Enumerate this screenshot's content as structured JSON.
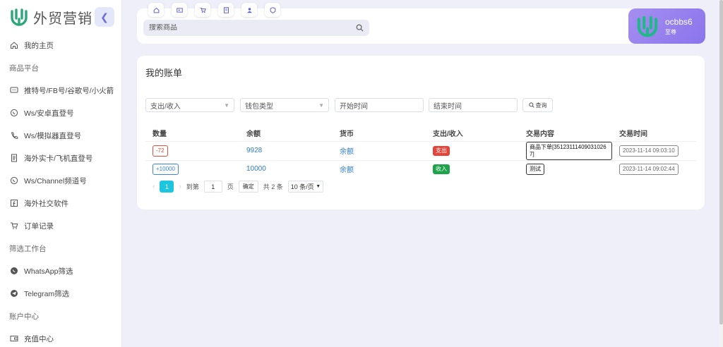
{
  "brand": {
    "name": "外贸营销",
    "color": "#2aa77b"
  },
  "sidebar": {
    "collapse_icon": "chevron-left-icon",
    "items": [
      {
        "type": "item",
        "label": "我的主页",
        "icon": "home-icon"
      },
      {
        "type": "group",
        "label": "商品平台"
      },
      {
        "type": "item",
        "label": "推特号/FB号/谷歌号/小火箭",
        "icon": "chat-icon"
      },
      {
        "type": "item",
        "label": "Ws/安卓直登号",
        "icon": "whatsapp-icon"
      },
      {
        "type": "item",
        "label": "Ws/模拟器直登号",
        "icon": "phone-icon"
      },
      {
        "type": "item",
        "label": "海外实卡/飞机直登号",
        "icon": "document-icon"
      },
      {
        "type": "item",
        "label": "Ws/Channel频道号",
        "icon": "whatsapp-icon"
      },
      {
        "type": "item",
        "label": "海外社交软件",
        "icon": "facebook-icon"
      },
      {
        "type": "item",
        "label": "订单记录",
        "icon": "cart-icon"
      },
      {
        "type": "group",
        "label": "筛选工作台"
      },
      {
        "type": "item",
        "label": "WhatsApp筛选",
        "icon": "whatsapp-fill-icon"
      },
      {
        "type": "item",
        "label": "Telegram筛选",
        "icon": "telegram-icon"
      },
      {
        "type": "group",
        "label": "账户中心"
      },
      {
        "type": "item",
        "label": "充值中心",
        "icon": "wallet-icon"
      }
    ]
  },
  "header": {
    "tabs": [
      "home-icon",
      "card-icon",
      "cart-icon",
      "list-icon",
      "user-icon",
      "shield-icon"
    ],
    "search": {
      "placeholder": "搜索商品",
      "icon": "search-icon"
    },
    "user": {
      "name": "ocbbs6",
      "level": "至尊"
    }
  },
  "main": {
    "title": "我的账单",
    "filters": {
      "type_select": "支出/收入",
      "wallet_select": "钱包类型",
      "start_placeholder": "开始时间",
      "end_placeholder": "结束时间",
      "query_label": "查询"
    },
    "columns": [
      "数量",
      "余额",
      "货币",
      "支出/收入",
      "交易内容",
      "交易时间"
    ],
    "rows": [
      {
        "amount": "-72",
        "balance": "9928",
        "currency": "余额",
        "direction": "支出",
        "content": "商品下单[35123111409031026​7]",
        "time": "2023-11-14 09:03:10"
      },
      {
        "amount": "+10000",
        "balance": "10000",
        "currency": "余额",
        "direction": "收入",
        "content": "测试",
        "time": "2023-11-14 09:02:44"
      }
    ],
    "pagination": {
      "prev": "‹",
      "current": "1",
      "next": "›",
      "goto_label": "到第",
      "goto_value": "1",
      "page_suffix": "页",
      "confirm_label": "确定",
      "total": "共 2 条",
      "page_size": "10 条/页"
    }
  }
}
